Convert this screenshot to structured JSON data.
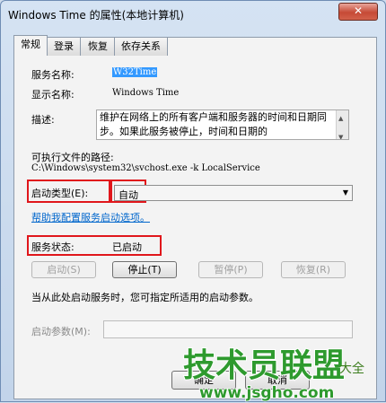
{
  "window": {
    "title": "Windows Time 的属性(本地计算机)",
    "close_label": "✕"
  },
  "tabs": [
    {
      "label": "常规"
    },
    {
      "label": "登录"
    },
    {
      "label": "恢复"
    },
    {
      "label": "依存关系"
    }
  ],
  "general": {
    "service_name_label": "服务名称:",
    "service_name_value": "W32Time",
    "display_name_label": "显示名称:",
    "display_name_value": "Windows Time",
    "description_label": "描述:",
    "description_value": "维护在网络上的所有客户端和服务器的时间和日期同步。如果此服务被停止，时间和日期的",
    "path_label": "可执行文件的路径:",
    "path_value": "C:\\Windows\\system32\\svchost.exe -k LocalService",
    "startup_type_label": "启动类型(E):",
    "startup_type_value": "自动",
    "help_link": "帮助我配置服务启动选项。",
    "service_status_label": "服务状态:",
    "service_status_value": "已启动",
    "buttons": {
      "start": "启动(S)",
      "stop": "停止(T)",
      "pause": "暂停(P)",
      "resume": "恢复(R)"
    },
    "hint": "当从此处启动服务时，您可指定所适用的启动参数。",
    "start_params_label": "启动参数(M):"
  },
  "footer": {
    "ok": "确定",
    "cancel": "取消"
  },
  "watermark": {
    "line1": "技术员联盟",
    "line2": "www.jsgho.com",
    "suffix": "大全"
  },
  "colors": {
    "highlight_box": "#e0161b",
    "watermark_green": "#2e9a2e"
  }
}
